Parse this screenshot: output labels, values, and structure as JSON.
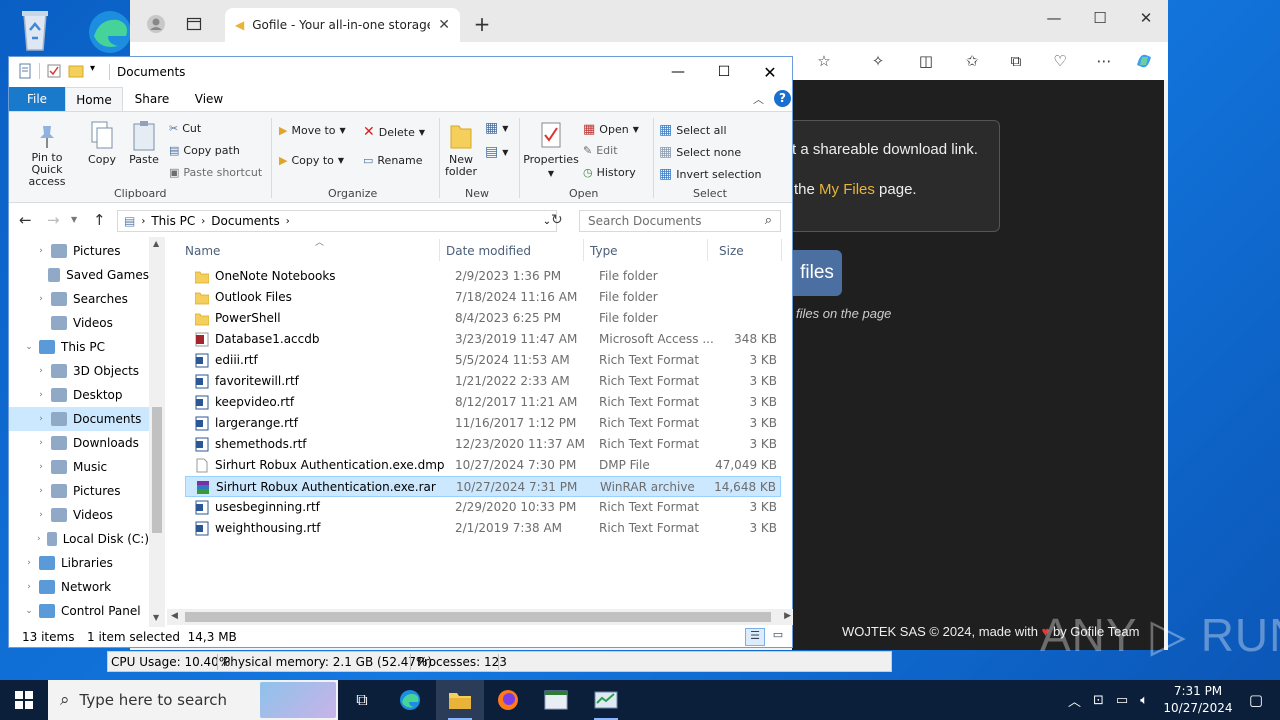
{
  "browser": {
    "tab_title": "Gofile - Your all-in-one storage s",
    "page": {
      "card_line1": "t a shareable download link.",
      "card_line2_prefix": "the ",
      "card_line2_link": "My Files",
      "card_line2_suffix": " page.",
      "files_button": "files",
      "files_hint": "files on the page",
      "footer_prefix": "WOJTEK SAS © 2024, made with ",
      "footer_heart": "♥",
      "footer_suffix": " by Gofile Team"
    }
  },
  "explorer": {
    "title": "Documents",
    "ribbon_tabs": [
      "File",
      "Home",
      "Share",
      "View"
    ],
    "ribbon": {
      "pin_label": "Pin to Quick access",
      "copy_label": "Copy",
      "paste_label": "Paste",
      "cut_label": "Cut",
      "copy_path_label": "Copy path",
      "paste_shortcut_label": "Paste shortcut",
      "clipboard_group": "Clipboard",
      "move_to_label": "Move to",
      "copy_to_label": "Copy to",
      "delete_label": "Delete",
      "rename_label": "Rename",
      "organize_group": "Organize",
      "new_folder_label": "New folder",
      "new_group": "New",
      "properties_label": "Properties",
      "open_label": "Open",
      "edit_label": "Edit",
      "history_label": "History",
      "open_group": "Open",
      "select_all_label": "Select all",
      "select_none_label": "Select none",
      "invert_selection_label": "Invert selection",
      "select_group": "Select"
    },
    "address": {
      "path": [
        "This PC",
        "Documents"
      ],
      "search_placeholder": "Search Documents"
    },
    "nav_items": [
      {
        "label": "Pictures",
        "indent": 2,
        "chevron": true
      },
      {
        "label": "Saved Games",
        "indent": 2,
        "chevron": false
      },
      {
        "label": "Searches",
        "indent": 2,
        "chevron": true
      },
      {
        "label": "Videos",
        "indent": 2,
        "chevron": false
      },
      {
        "label": "This PC",
        "indent": 1,
        "chevron": true,
        "expanded": true
      },
      {
        "label": "3D Objects",
        "indent": 2,
        "chevron": true
      },
      {
        "label": "Desktop",
        "indent": 2,
        "chevron": true
      },
      {
        "label": "Documents",
        "indent": 2,
        "chevron": true,
        "selected": true
      },
      {
        "label": "Downloads",
        "indent": 2,
        "chevron": true
      },
      {
        "label": "Music",
        "indent": 2,
        "chevron": true
      },
      {
        "label": "Pictures",
        "indent": 2,
        "chevron": true
      },
      {
        "label": "Videos",
        "indent": 2,
        "chevron": true
      },
      {
        "label": "Local Disk (C:)",
        "indent": 2,
        "chevron": true
      },
      {
        "label": "Libraries",
        "indent": 1,
        "chevron": true
      },
      {
        "label": "Network",
        "indent": 1,
        "chevron": true
      },
      {
        "label": "Control Panel",
        "indent": 1,
        "chevron": true,
        "expanded": true
      }
    ],
    "columns": {
      "name": "Name",
      "date": "Date modified",
      "type": "Type",
      "size": "Size"
    },
    "files": [
      {
        "name": "OneNote Notebooks",
        "date": "2/9/2023 1:36 PM",
        "type": "File folder",
        "size": "",
        "icon": "folder-icon"
      },
      {
        "name": "Outlook Files",
        "date": "7/18/2024 11:16 AM",
        "type": "File folder",
        "size": "",
        "icon": "folder-icon"
      },
      {
        "name": "PowerShell",
        "date": "8/4/2023 6:25 PM",
        "type": "File folder",
        "size": "",
        "icon": "folder-icon"
      },
      {
        "name": "Database1.accdb",
        "date": "3/23/2019 11:47 AM",
        "type": "Microsoft Access ...",
        "size": "348 KB",
        "icon": "access-file-icon"
      },
      {
        "name": "ediii.rtf",
        "date": "5/5/2024 11:53 AM",
        "type": "Rich Text Format",
        "size": "3 KB",
        "icon": "rtf-file-icon"
      },
      {
        "name": "favoritewill.rtf",
        "date": "1/21/2022 2:33 AM",
        "type": "Rich Text Format",
        "size": "3 KB",
        "icon": "rtf-file-icon"
      },
      {
        "name": "keepvideo.rtf",
        "date": "8/12/2017 11:21 AM",
        "type": "Rich Text Format",
        "size": "3 KB",
        "icon": "rtf-file-icon"
      },
      {
        "name": "largerange.rtf",
        "date": "11/16/2017 1:12 PM",
        "type": "Rich Text Format",
        "size": "3 KB",
        "icon": "rtf-file-icon"
      },
      {
        "name": "shemethods.rtf",
        "date": "12/23/2020 11:37 AM",
        "type": "Rich Text Format",
        "size": "3 KB",
        "icon": "rtf-file-icon"
      },
      {
        "name": "Sirhurt Robux Authentication.exe.dmp",
        "date": "10/27/2024 7:30 PM",
        "type": "DMP File",
        "size": "47,049 KB",
        "icon": "blank-file-icon"
      },
      {
        "name": "Sirhurt Robux Authentication.exe.rar",
        "date": "10/27/2024 7:31 PM",
        "type": "WinRAR archive",
        "size": "14,648 KB",
        "icon": "winrar-file-icon",
        "selected": true
      },
      {
        "name": "usesbeginning.rtf",
        "date": "2/29/2020 10:33 PM",
        "type": "Rich Text Format",
        "size": "3 KB",
        "icon": "rtf-file-icon"
      },
      {
        "name": "weighthousing.rtf",
        "date": "2/1/2019 7:38 AM",
        "type": "Rich Text Format",
        "size": "3 KB",
        "icon": "rtf-file-icon"
      }
    ],
    "status": {
      "items_count": "13 items",
      "selected": "1 item selected  14,3 MB"
    }
  },
  "procbar": {
    "cpu": "CPU Usage: 10.40%",
    "memory": "Physical memory: 2.1 GB (52.47%)",
    "processes": "Processes: 123"
  },
  "taskbar": {
    "search_placeholder": "Type here to search",
    "time": "7:31 PM",
    "date": "10/27/2024"
  },
  "watermark": "ANY ▷ RUN",
  "colors": {
    "accent": "#1979ca",
    "selection": "#cce8ff",
    "link": "#e8b339"
  }
}
